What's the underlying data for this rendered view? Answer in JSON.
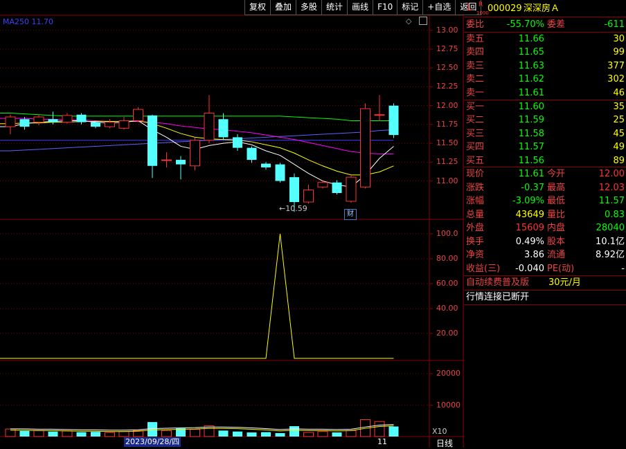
{
  "toolbar": [
    "复权",
    "叠加",
    "多股",
    "统计",
    "画线",
    "F10",
    "标记",
    "+自选",
    "返回"
  ],
  "ma_label": "MA250  11.70",
  "price_axis": [
    "13.00",
    "12.75",
    "12.50",
    "12.25",
    "12.00",
    "11.75",
    "11.50",
    "11.25",
    "11.00"
  ],
  "ind_axis": [
    "100.0",
    "80.00",
    "60.00",
    "40.00",
    "20.00"
  ],
  "vol_axis": [
    "20000",
    "10000"
  ],
  "vol_unit": "X10",
  "low_marker": "10.59",
  "cai_marker": "财",
  "date_label": "2023/09/28/四",
  "end_label": "11",
  "period_label": "日线",
  "stock": {
    "flag": "L",
    "mark": "R",
    "sub": "1000",
    "code": "000029",
    "name": "深深房Ａ"
  },
  "weibi": {
    "label": "委比",
    "value": "-55.70%",
    "label2": "委差",
    "value2": "-611"
  },
  "sells": [
    {
      "label": "卖五",
      "price": "11.66",
      "vol": "30"
    },
    {
      "label": "卖四",
      "price": "11.65",
      "vol": "99"
    },
    {
      "label": "卖三",
      "price": "11.63",
      "vol": "377"
    },
    {
      "label": "卖二",
      "price": "11.62",
      "vol": "302"
    },
    {
      "label": "卖一",
      "price": "11.61",
      "vol": "46"
    }
  ],
  "buys": [
    {
      "label": "买一",
      "price": "11.60",
      "vol": "35"
    },
    {
      "label": "买二",
      "price": "11.59",
      "vol": "25"
    },
    {
      "label": "买三",
      "price": "11.58",
      "vol": "45"
    },
    {
      "label": "买四",
      "price": "11.57",
      "vol": "49"
    },
    {
      "label": "买五",
      "price": "11.56",
      "vol": "89"
    }
  ],
  "stats": [
    {
      "l1": "现价",
      "v1": "11.61",
      "c1": "green",
      "l2": "今开",
      "v2": "12.00",
      "c2": "red"
    },
    {
      "l1": "涨跌",
      "v1": "-0.37",
      "c1": "green",
      "l2": "最高",
      "v2": "12.03",
      "c2": "red"
    },
    {
      "l1": "涨幅",
      "v1": "-3.09%",
      "c1": "green",
      "l2": "最低",
      "v2": "11.57",
      "c2": "green"
    },
    {
      "l1": "总量",
      "v1": "43649",
      "c1": "yellow",
      "l2": "量比",
      "v2": "0.83",
      "c2": "green"
    },
    {
      "l1": "外盘",
      "v1": "15609",
      "c1": "red",
      "l2": "内盘",
      "v2": "28040",
      "c2": "green"
    },
    {
      "l1": "换手",
      "v1": "0.49%",
      "c1": "white",
      "l2": "股本",
      "v2": "10.1亿",
      "c2": "white"
    },
    {
      "l1": "净资",
      "v1": "3.86",
      "c1": "white",
      "l2": "流通",
      "v2": "8.92亿",
      "c2": "white"
    },
    {
      "l1": "收益(三)",
      "v1": "-0.040",
      "c1": "white",
      "l2": "PE(动)",
      "v2": "-",
      "c2": "white"
    }
  ],
  "promo": {
    "text": "自动续费普及版",
    "price": "30元/月"
  },
  "status": "行情连接已断开",
  "colors": {
    "up": "#ff3232",
    "down": "#54ffff",
    "grid": "#8b0000",
    "ma5": "#ffffff",
    "ma10": "#ffff00",
    "ma20": "#ff00ff",
    "ma60": "#00ff00",
    "ma120": "#4040ff"
  },
  "candles": [
    {
      "o": 11.72,
      "c": 11.85,
      "h": 11.88,
      "l": 11.62
    },
    {
      "o": 11.82,
      "c": 11.72,
      "h": 11.85,
      "l": 11.68
    },
    {
      "o": 11.78,
      "c": 11.85,
      "h": 11.88,
      "l": 11.74
    },
    {
      "o": 11.82,
      "c": 11.78,
      "h": 11.92,
      "l": 11.75
    },
    {
      "o": 11.78,
      "c": 11.87,
      "h": 11.9,
      "l": 11.76
    },
    {
      "o": 11.88,
      "c": 11.78,
      "h": 11.9,
      "l": 11.75
    },
    {
      "o": 11.78,
      "c": 11.72,
      "h": 11.8,
      "l": 11.7
    },
    {
      "o": 11.72,
      "c": 11.78,
      "h": 11.82,
      "l": 11.7
    },
    {
      "o": 11.7,
      "c": 11.8,
      "h": 11.85,
      "l": 11.68
    },
    {
      "o": 11.8,
      "c": 11.95,
      "h": 11.98,
      "l": 11.78
    },
    {
      "o": 11.87,
      "c": 11.2,
      "h": 11.88,
      "l": 11.04
    },
    {
      "o": 11.28,
      "c": 11.28,
      "h": 11.38,
      "l": 11.18
    },
    {
      "o": 11.28,
      "c": 11.22,
      "h": 11.33,
      "l": 11.02
    },
    {
      "o": 11.2,
      "c": 11.54,
      "h": 11.58,
      "l": 11.14
    },
    {
      "o": 11.54,
      "c": 11.9,
      "h": 12.14,
      "l": 11.5
    },
    {
      "o": 11.82,
      "c": 11.58,
      "h": 11.9,
      "l": 11.55
    },
    {
      "o": 11.58,
      "c": 11.44,
      "h": 11.62,
      "l": 11.4
    },
    {
      "o": 11.44,
      "c": 11.28,
      "h": 11.46,
      "l": 11.24
    },
    {
      "o": 11.23,
      "c": 11.18,
      "h": 11.25,
      "l": 11.15
    },
    {
      "o": 11.22,
      "c": 11.0,
      "h": 11.24,
      "l": 10.98
    },
    {
      "o": 11.05,
      "c": 10.72,
      "h": 11.1,
      "l": 10.59
    },
    {
      "o": 10.72,
      "c": 10.88,
      "h": 10.95,
      "l": 10.7
    },
    {
      "o": 10.92,
      "c": 10.98,
      "h": 11.0,
      "l": 10.9
    },
    {
      "o": 10.98,
      "c": 10.84,
      "h": 11.01,
      "l": 10.82
    },
    {
      "o": 10.73,
      "c": 11.05,
      "h": 11.07,
      "l": 10.71
    },
    {
      "o": 10.92,
      "c": 11.96,
      "h": 12.03,
      "l": 10.9
    },
    {
      "o": 11.88,
      "c": 11.88,
      "h": 12.14,
      "l": 11.8
    },
    {
      "o": 12.0,
      "c": 11.61,
      "h": 12.03,
      "l": 11.57
    }
  ],
  "ma": {
    "ma5": [
      11.72,
      11.76,
      11.78,
      11.79,
      11.8,
      11.8,
      11.78,
      11.77,
      11.78,
      11.8,
      11.68,
      11.58,
      11.46,
      11.42,
      11.47,
      11.5,
      11.52,
      11.48,
      11.4,
      11.34,
      11.22,
      11.1,
      11.0,
      10.95,
      10.92,
      11.08,
      11.3,
      11.46
    ],
    "ma10": [
      11.76,
      11.77,
      11.77,
      11.78,
      11.78,
      11.79,
      11.79,
      11.79,
      11.79,
      11.8,
      11.76,
      11.7,
      11.63,
      11.58,
      11.56,
      11.55,
      11.54,
      11.52,
      11.48,
      11.44,
      11.37,
      11.28,
      11.2,
      11.13,
      11.08,
      11.08,
      11.12,
      11.2
    ],
    "ma20": [
      11.83,
      11.83,
      11.82,
      11.82,
      11.81,
      11.81,
      11.8,
      11.79,
      11.79,
      11.79,
      11.78,
      11.76,
      11.73,
      11.71,
      11.69,
      11.68,
      11.66,
      11.64,
      11.61,
      11.58,
      11.55,
      11.51,
      11.47,
      11.43,
      11.39,
      11.37,
      11.36,
      11.36
    ],
    "ma60": [
      11.9,
      11.89,
      11.88,
      11.87,
      11.86,
      11.86,
      11.86,
      11.86,
      11.86,
      11.86,
      11.86,
      11.86,
      11.86,
      11.86,
      11.86,
      11.86,
      11.86,
      11.86,
      11.86,
      11.86,
      11.85,
      11.84,
      11.83,
      11.82,
      11.8,
      11.8,
      11.8,
      11.8
    ],
    "ma120": [
      11.4,
      11.41,
      11.42,
      11.43,
      11.44,
      11.45,
      11.46,
      11.47,
      11.48,
      11.49,
      11.5,
      11.51,
      11.52,
      11.53,
      11.54,
      11.55,
      11.56,
      11.57,
      11.58,
      11.59,
      11.6,
      11.61,
      11.62,
      11.63,
      11.64,
      11.65,
      11.67,
      11.68
    ],
    "ma250": [
      11.54,
      11.54,
      11.54,
      11.54,
      11.54,
      11.54,
      11.54,
      11.54,
      11.54,
      11.54,
      11.54,
      11.54,
      11.54,
      11.54,
      11.54,
      11.54,
      11.54,
      11.54,
      11.54,
      11.54,
      11.54,
      11.54,
      11.54,
      11.54,
      11.54,
      11.54,
      11.54,
      11.54
    ]
  },
  "indicator": [
    0,
    0,
    0,
    0,
    0,
    0,
    0,
    0,
    0,
    0,
    0,
    0,
    0,
    0,
    0,
    0,
    0,
    0,
    0,
    100,
    0,
    0,
    0,
    0,
    0,
    0,
    0,
    0
  ],
  "volume": [
    2400,
    1800,
    1900,
    1600,
    1800,
    1400,
    1500,
    1300,
    1600,
    1900,
    4600,
    1900,
    2600,
    2300,
    3400,
    1900,
    1600,
    1300,
    1400,
    1100,
    3300,
    1300,
    1600,
    1300,
    1900,
    5400,
    4800,
    3200
  ],
  "vol_ma": [
    2000,
    2000,
    1900,
    1900,
    1800,
    1700,
    1700,
    1600,
    1600,
    1700,
    2100,
    2200,
    2300,
    2400,
    2600,
    2600,
    2500,
    2300,
    2100,
    1800,
    2000,
    1900,
    1900,
    1800,
    1900,
    2600,
    3200,
    3400
  ]
}
